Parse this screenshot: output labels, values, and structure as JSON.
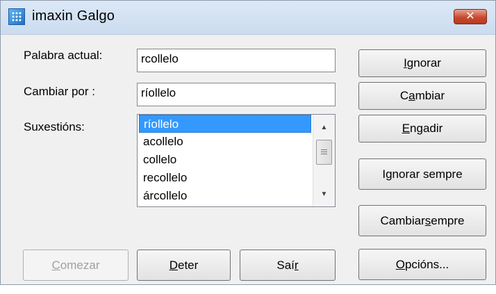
{
  "window": {
    "title": "imaxin Galgo",
    "close_glyph": "✕"
  },
  "form": {
    "current_word_label": "Palabra actual:",
    "current_word_value": "rcollelo",
    "replace_label": "Cambiar por :",
    "replace_value": "ríollelo",
    "suggestions_label": "Suxestións:",
    "suggestions": [
      "ríollelo",
      "acollelo",
      "collelo",
      "recollelo",
      "árcollelo"
    ],
    "selected_index": 0
  },
  "buttons": {
    "ignore": {
      "pre": "",
      "key": "I",
      "post": "gnorar"
    },
    "change": {
      "pre": "C",
      "key": "a",
      "post": "mbiar"
    },
    "add": {
      "pre": "",
      "key": "E",
      "post": "ngadir"
    },
    "ignore_all": {
      "pre": "I",
      "key": "g",
      "post": "norar sempre"
    },
    "change_all": {
      "pre": "Cambiar ",
      "key": "s",
      "post": "empre"
    },
    "start": {
      "pre": "",
      "key": "C",
      "post": "omezar"
    },
    "stop": {
      "pre": "",
      "key": "D",
      "post": "eter"
    },
    "exit": {
      "pre": "Saí",
      "key": "r",
      "post": ""
    },
    "options": {
      "pre": "",
      "key": "O",
      "post": "pcións..."
    }
  },
  "icons": {
    "app": "app-icon",
    "close": "close-icon",
    "scroll_up": "scroll-up-arrow-icon",
    "scroll_down": "scroll-down-arrow-icon"
  },
  "colors": {
    "selection": "#3399ff",
    "close_button": "#c74a30",
    "titlebar": "#cbdcef"
  }
}
